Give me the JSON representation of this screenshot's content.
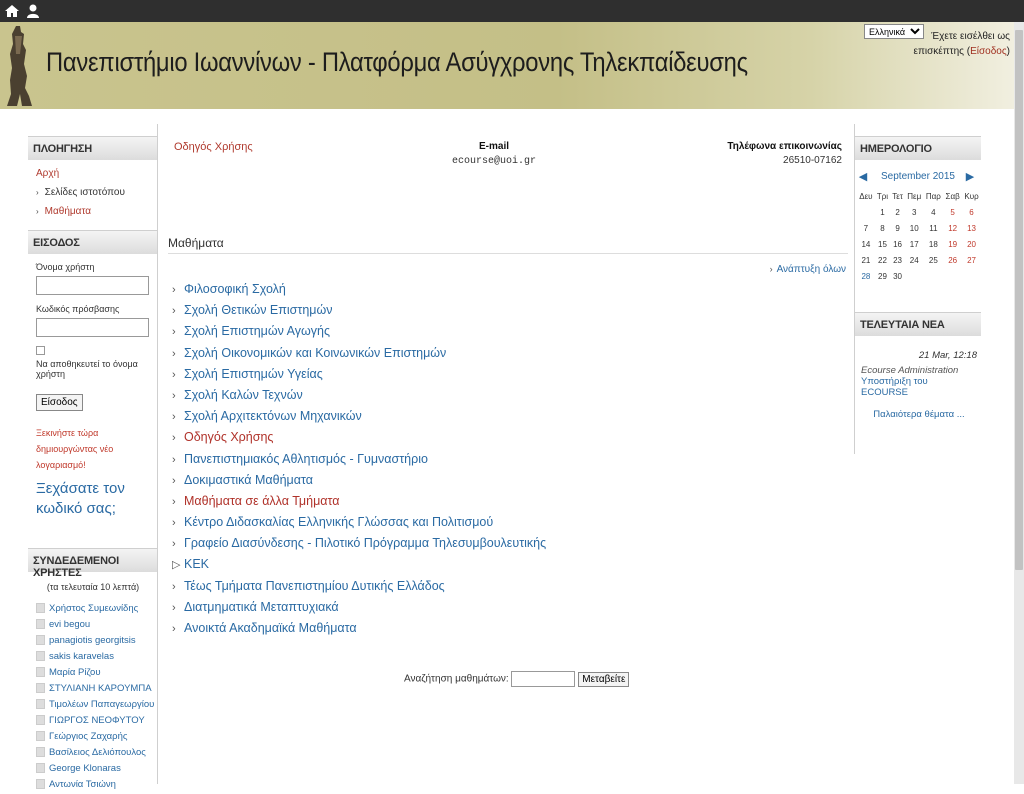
{
  "header": {
    "title": "Πανεπιστήμιο Ιωαννίνων - Πλατφόρμα Ασύγχρονης Τηλεκπαίδευσης",
    "language": "Ελληνικά (el)",
    "login_status_prefix": "Έχετε εισέλθει ως επισκέπτης (",
    "login_link": "Είσοδος",
    "login_status_suffix": ")"
  },
  "nav": {
    "title": "ΠΛΟΗΓΗΣΗ",
    "home": "Αρχή",
    "site_pages": "Σελίδες ιστοτόπου",
    "courses": "Μαθήματα"
  },
  "login": {
    "title": "ΕΙΣΟΔΟΣ",
    "username_label": "Όνομα χρήστη",
    "password_label": "Κωδικός πρόσβασης",
    "remember_label": "Να αποθηκευτεί το όνομα χρήστη",
    "submit": "Είσοδος",
    "signup": "Ξεκινήστε τώρα δημιουργώντας νέο λογαριασμό!",
    "forgot": "Ξεχάσατε τον κωδικό σας;"
  },
  "online": {
    "title": "ΣΥΝΔΕΔΕΜΕΝΟΙ ΧΡΗΣΤΕΣ",
    "note": "(τα τελευταία 10 λεπτά)",
    "users": [
      "Χρήστος Συμεωνίδης",
      "evi begou",
      "panagiotis georgitsis",
      "sakis karavelas",
      "Μαρία Ρίζου",
      "ΣΤΥΛΙΑΝΗ ΚΑΡΟΥΜΠΑ",
      "Τιμολέων Παπαγεωργίου",
      "ΓΙΩΡΓΟΣ ΝΕΟΦΥΤΟΥ",
      "Γεώργιος Ζαχαρής",
      "Βασίλειος Δελιόπουλος",
      "George Klonaras",
      "Αντωνία Τσιώνη"
    ]
  },
  "info": {
    "guide": "Οδηγός Χρήσης",
    "email_label": "E-mail",
    "email": "ecourse@uoi.gr",
    "phone_label": "Τηλέφωνα επικοινωνίας",
    "phone": "26510-07162"
  },
  "courses": {
    "title": "Μαθήματα",
    "expand_all": "Ανάπτυξη όλων",
    "categories": [
      {
        "label": "Φιλοσοφική Σχολή",
        "color": "blue"
      },
      {
        "label": "Σχολή Θετικών Επιστημών",
        "color": "blue"
      },
      {
        "label": "Σχολή Επιστημών Αγωγής",
        "color": "blue"
      },
      {
        "label": "Σχολή Οικονομικών και Κοινωνικών Επιστημών",
        "color": "blue"
      },
      {
        "label": "Σχολή Επιστημών Υγείας",
        "color": "blue"
      },
      {
        "label": "Σχολή Καλών Τεχνών",
        "color": "blue"
      },
      {
        "label": "Σχολή Αρχιτεκτόνων Μηχανικών",
        "color": "blue"
      },
      {
        "label": "Οδηγός Χρήσης",
        "color": "red"
      },
      {
        "label": "Πανεπιστημιακός Αθλητισμός - Γυμναστήριο",
        "color": "blue"
      },
      {
        "label": "Δοκιμαστικά Μαθήματα",
        "color": "blue"
      },
      {
        "label": "Μαθήματα σε άλλα Τμήματα",
        "color": "red"
      },
      {
        "label": "Κέντρο Διδασκαλίας Ελληνικής Γλώσσας και Πολιτισμού",
        "color": "blue"
      },
      {
        "label": "Γραφείο Διασύνδεσης - Πιλοτικό Πρόγραμμα Τηλεσυμβουλευτικής",
        "color": "blue"
      },
      {
        "label": "ΚΕΚ",
        "color": "blue",
        "empty": true
      },
      {
        "label": "Τέως Τμήματα Πανεπιστημίου Δυτικής Ελλάδος",
        "color": "blue"
      },
      {
        "label": "Διατμηματικά Μεταπτυχιακά",
        "color": "blue"
      },
      {
        "label": "Ανοικτά Ακαδημαϊκά Μαθήματα",
        "color": "blue"
      }
    ],
    "search_label": "Αναζήτηση μαθημάτων:",
    "search_button": "Μεταβείτε"
  },
  "calendar": {
    "title": "ΗΜΕΡΟΛΟΓΙΟ",
    "month": "September 2015",
    "days": [
      "Δευ",
      "Τρι",
      "Τετ",
      "Πεμ",
      "Παρ",
      "Σαβ",
      "Κυρ"
    ],
    "weeks": [
      [
        "",
        "1",
        "2",
        "3",
        "4",
        "5",
        "6"
      ],
      [
        "7",
        "8",
        "9",
        "10",
        "11",
        "12",
        "13"
      ],
      [
        "14",
        "15",
        "16",
        "17",
        "18",
        "19",
        "20"
      ],
      [
        "21",
        "22",
        "23",
        "24",
        "25",
        "26",
        "27"
      ],
      [
        "28",
        "29",
        "30",
        "",
        "",
        "",
        ""
      ]
    ]
  },
  "news": {
    "title": "ΤΕΛΕΥΤΑΙΑ ΝΕΑ",
    "date": "21 Mar, 12:18",
    "author": "Ecourse Administration",
    "headline": "Υποστήριξη του ECOURSE",
    "older": "Παλαιότερα θέματα ..."
  },
  "colors": {
    "accent_blue": "#2a6aa3",
    "accent_red": "#b0322a",
    "header_bg": "#c9c48e"
  },
  "icons": [
    "home-icon",
    "user-icon",
    "university-logo",
    "chevron-right-icon",
    "triangle-left-icon",
    "triangle-right-icon",
    "user-avatar-icon"
  ]
}
